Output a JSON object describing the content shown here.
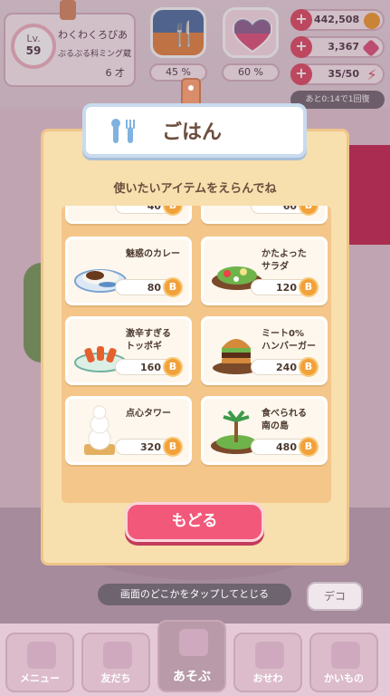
{
  "profile": {
    "level_label": "Lv.",
    "level": "59",
    "name": "わくわくろびあ",
    "subtitle": "ぷるぷる科ミング蔵",
    "age": "6 才"
  },
  "stats": {
    "food_pct": "45 %",
    "heart_pct": "60 %"
  },
  "currency": {
    "coins": "442,508",
    "gems": "3,367",
    "energy": "35/50",
    "recover": "あと0:14で1回復"
  },
  "modal": {
    "title": "ごはん",
    "subtitle": "使いたいアイテムをえらんでね",
    "partial_prices": [
      "40",
      "60"
    ],
    "items": [
      {
        "name": "魅惑のカレー",
        "price": "80"
      },
      {
        "name": "かたよった\nサラダ",
        "price": "120"
      },
      {
        "name": "激辛すぎる\nトッポギ",
        "price": "160"
      },
      {
        "name": "ミート0%\nハンバーガー",
        "price": "240"
      },
      {
        "name": "点心タワー",
        "price": "320"
      },
      {
        "name": "食べられる\n南の島",
        "price": "480"
      }
    ],
    "back_label": "もどる",
    "coin_symbol": "B"
  },
  "tap_hint": "画面のどこかをタップしてとじる",
  "deco_label": "デコ",
  "nav": [
    {
      "label": "メニュー"
    },
    {
      "label": "友だち"
    },
    {
      "label": "あそぶ"
    },
    {
      "label": "おせわ"
    },
    {
      "label": "かいもの"
    }
  ],
  "colors": {
    "accent": "#f1587a",
    "coin": "#f2a13a",
    "modal_bg": "#f8dfae"
  }
}
